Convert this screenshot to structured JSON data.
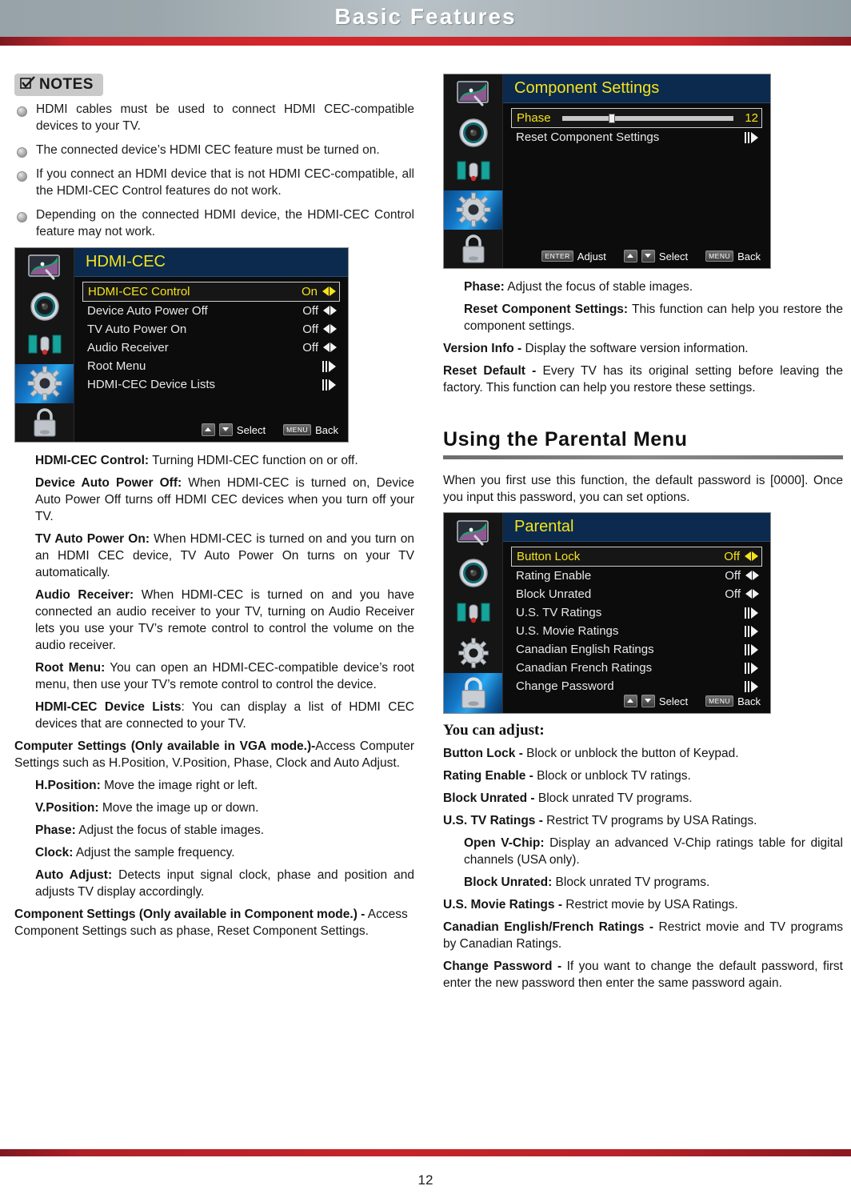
{
  "header": {
    "title": "Basic Features"
  },
  "footer": {
    "page_number": "12"
  },
  "notes": {
    "badge_label": "NOTES",
    "badge_icon": "checkbox-checked-icon",
    "items": [
      "HDMI cables must be used to connect HDMI CEC-compatible devices to your TV.",
      "The connected device’s HDMI CEC feature must be turned on.",
      "If you connect an HDMI device that is not HDMI CEC-compatible, all the HDMI-CEC Control features do not work.",
      "Depending on the connected HDMI device, the HDMI-CEC Control feature may not work."
    ]
  },
  "osd_hdmi_cec": {
    "title": "HDMI-CEC",
    "sidebar_icons": [
      "picture-icon",
      "speaker-icon",
      "antenna-icon",
      "gear-icon",
      "lock-icon"
    ],
    "active_icon_index": 3,
    "rows": [
      {
        "label": "HDMI-CEC Control",
        "value": "On",
        "control": "lr-arrow",
        "selected": true
      },
      {
        "label": "Device Auto Power Off",
        "value": "Off",
        "control": "lr-arrow",
        "selected": false
      },
      {
        "label": "TV Auto Power On",
        "value": "Off",
        "control": "lr-arrow",
        "selected": false
      },
      {
        "label": "Audio Receiver",
        "value": "Off",
        "control": "lr-arrow",
        "selected": false
      },
      {
        "label": "Root Menu",
        "value": "",
        "control": "sub-arrow",
        "selected": false
      },
      {
        "label": "HDMI-CEC Device Lists",
        "value": "",
        "control": "sub-arrow",
        "selected": false
      }
    ],
    "hints": [
      {
        "key": "",
        "icon": "updown-keys-icon",
        "label": "Select"
      },
      {
        "key": "MENU",
        "icon": "",
        "label": "Back"
      }
    ]
  },
  "osd_component": {
    "title": "Component Settings",
    "sidebar_icons": [
      "picture-icon",
      "speaker-icon",
      "antenna-icon",
      "gear-icon",
      "lock-icon"
    ],
    "active_icon_index": 3,
    "rows": [
      {
        "label": "Phase",
        "value": "12",
        "control": "slider",
        "slider_percent": 27,
        "selected": true
      },
      {
        "label": "Reset Component Settings",
        "value": "",
        "control": "sub-arrow",
        "selected": false
      }
    ],
    "hints": [
      {
        "key": "ENTER",
        "icon": "",
        "label": "Adjust"
      },
      {
        "key": "",
        "icon": "updown-keys-icon",
        "label": "Select"
      },
      {
        "key": "MENU",
        "icon": "",
        "label": "Back"
      }
    ]
  },
  "osd_parental": {
    "title": "Parental",
    "sidebar_icons": [
      "picture-icon",
      "speaker-icon",
      "antenna-icon",
      "gear-icon",
      "lock-icon"
    ],
    "active_icon_index": 4,
    "rows": [
      {
        "label": "Button Lock",
        "value": "Off",
        "control": "lr-arrow",
        "selected": true
      },
      {
        "label": "Rating Enable",
        "value": "Off",
        "control": "lr-arrow",
        "selected": false
      },
      {
        "label": "Block Unrated",
        "value": "Off",
        "control": "lr-arrow",
        "selected": false
      },
      {
        "label": "U.S. TV Ratings",
        "value": "",
        "control": "sub-arrow",
        "selected": false
      },
      {
        "label": "U.S. Movie Ratings",
        "value": "",
        "control": "sub-arrow",
        "selected": false
      },
      {
        "label": "Canadian English Ratings",
        "value": "",
        "control": "sub-arrow",
        "selected": false
      },
      {
        "label": "Canadian French Ratings",
        "value": "",
        "control": "sub-arrow",
        "selected": false
      },
      {
        "label": "Change Password",
        "value": "",
        "control": "sub-arrow",
        "selected": false
      }
    ],
    "hints": [
      {
        "key": "",
        "icon": "updown-keys-icon",
        "label": "Select"
      },
      {
        "key": "MENU",
        "icon": "",
        "label": "Back"
      }
    ]
  },
  "left_body": {
    "p1_bold": "HDMI-CEC Control:",
    "p1_rest": " Turning HDMI-CEC function on or off.",
    "p2_bold": "Device Auto Power Off:",
    "p2_rest": " When HDMI-CEC is turned on, Device Auto Power Off turns off HDMI CEC devices when you turn off your TV.",
    "p3_bold": "TV Auto Power On:",
    "p3_rest": " When HDMI-CEC is turned on and you turn on an HDMI CEC device, TV Auto Power On turns on your TV automatically.",
    "p4_bold": "Audio Receiver:",
    "p4_rest": " When HDMI-CEC is turned on and you have connected an audio receiver to your TV, turning on Audio Receiver lets you use your TV’s remote control to control the volume on the audio receiver.",
    "p5_bold": "Root Menu:",
    "p5_rest": " You can open an HDMI-CEC-compatible device’s root menu, then use your TV’s remote control to control the device.",
    "p6_bold": "HDMI-CEC Device Lists",
    "p6_rest": ": You can display a list of HDMI CEC devices that are connected to your TV.",
    "p7_bold": "Computer Settings (Only available in VGA mode.)-",
    "p7_rest": "Access Computer Settings such as H.Position, V.Position, Phase, Clock and Auto Adjust.",
    "p8_bold": "H.Position:",
    "p8_rest": " Move the image right or left.",
    "p9_bold": "V.Position:",
    "p9_rest": " Move the image up or down.",
    "p10_bold": "Phase:",
    "p10_rest": " Adjust the focus of stable images.",
    "p11_bold": "Clock:",
    "p11_rest": " Adjust the sample frequency.",
    "p12_bold": "Auto Adjust:",
    "p12_rest": " Detects input signal clock, phase and position and adjusts TV display accordingly.",
    "p13_bold": "Component Settings (Only available in Component mode.) -",
    "p13_rest": " Access Component Settings such as phase, Reset Component Settings."
  },
  "right_body": {
    "r1_bold": "Phase:",
    "r1_rest": " Adjust the focus of stable images.",
    "r2_bold": "Reset Component Settings:",
    "r2_rest": " This function can help you restore the component settings.",
    "r3_bold": "Version Info -",
    "r3_rest": " Display the software version information.",
    "r4_bold": "Reset Default -",
    "r4_rest": " Every TV has its original setting before leaving the factory. This function can help you restore these settings.",
    "section_heading": "Using the Parental Menu",
    "intro": "When you first use this function, the default password is [0000]. Once you input this password, you can set options.",
    "you_can_adjust": "You can adjust:",
    "a1_bold": "Button Lock -",
    "a1_rest": " Block or unblock the button of Keypad.",
    "a2_bold": "Rating Enable -",
    "a2_rest": " Block or unblock TV ratings.",
    "a3_bold": "Block Unrated -",
    "a3_rest": " Block unrated TV programs.",
    "a4_bold": "U.S. TV Ratings -",
    "a4_rest": " Restrict TV programs by USA Ratings.",
    "a5_bold": "Open V-Chip:",
    "a5_rest": " Display an advanced V-Chip ratings table for digital channels (USA only).",
    "a6_bold": "Block Unrated:",
    "a6_rest": " Block unrated TV programs.",
    "a7_bold": "U.S. Movie Ratings -",
    "a7_rest": " Restrict movie by USA Ratings.",
    "a8_bold": "Canadian English/French Ratings -",
    "a8_rest": " Restrict movie and TV programs by Canadian Ratings.",
    "a9_bold": "Change Password -",
    "a9_rest": " If you want to change the default password, first enter the new password then enter the same password again."
  }
}
